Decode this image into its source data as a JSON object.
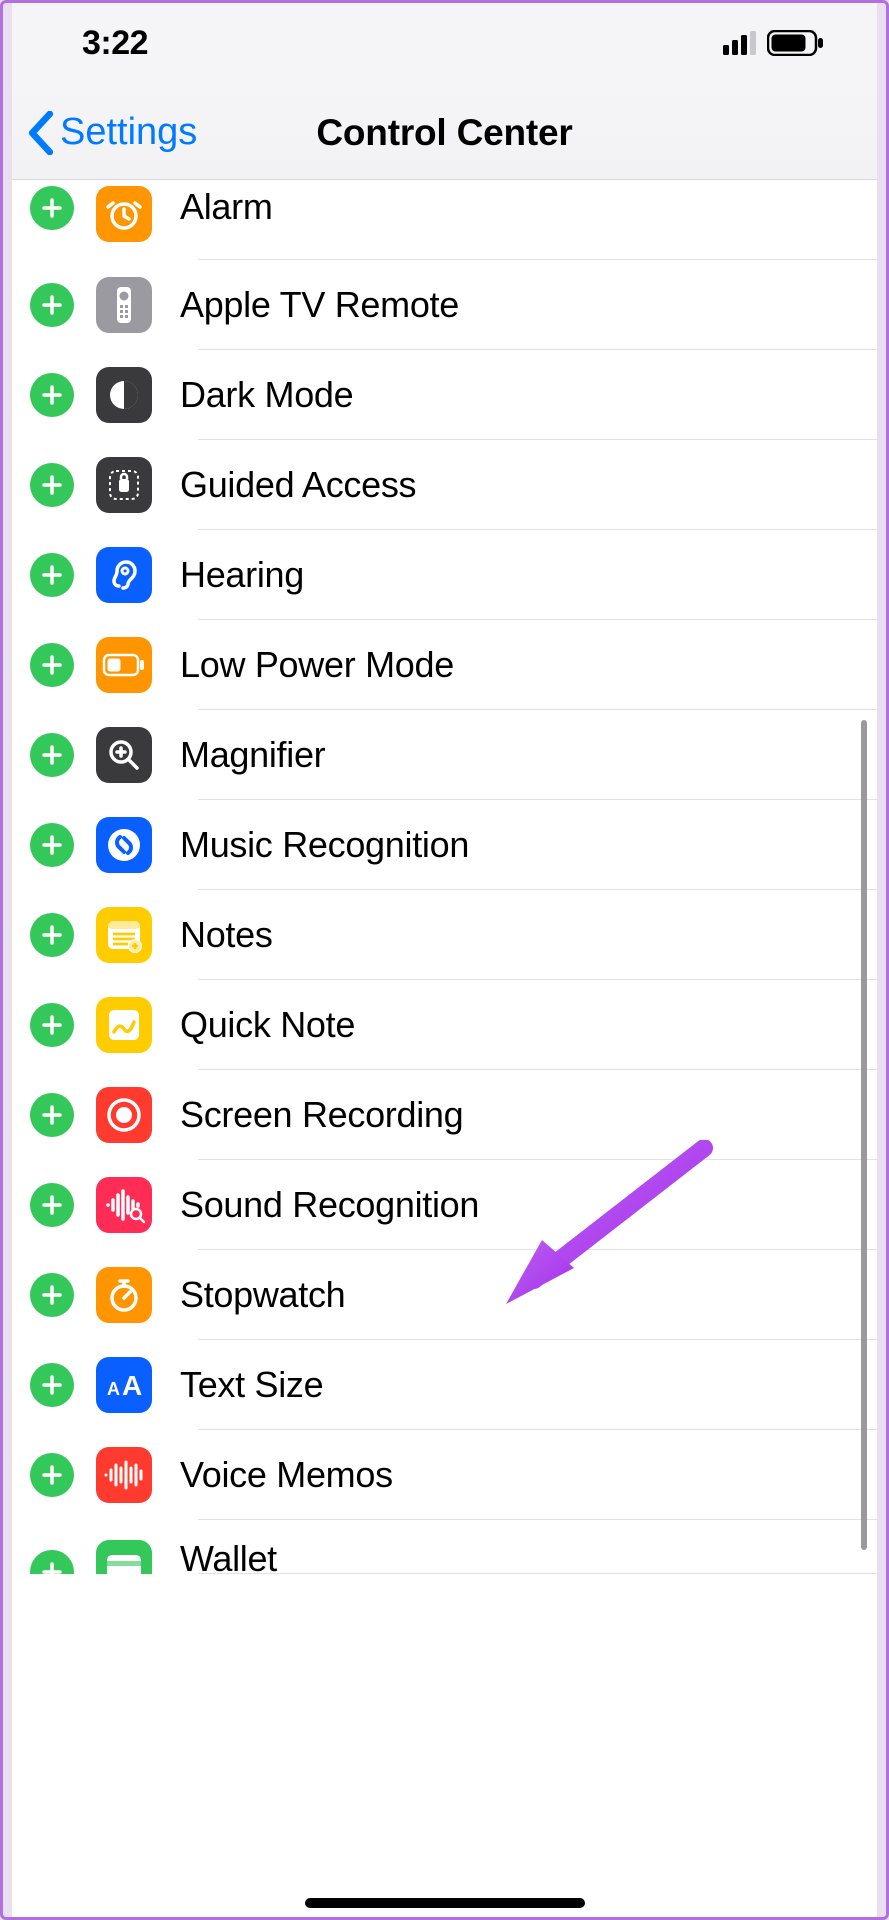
{
  "status": {
    "time": "3:22"
  },
  "nav": {
    "back_label": "Settings",
    "title": "Control Center"
  },
  "controls": [
    {
      "id": "alarm",
      "label": "Alarm",
      "icon_bg": "#ff9500",
      "icon": "alarm"
    },
    {
      "id": "apple-tv-remote",
      "label": "Apple TV Remote",
      "icon_bg": "#9a9aa0",
      "icon": "remote"
    },
    {
      "id": "dark-mode",
      "label": "Dark Mode",
      "icon_bg": "#3a3a3c",
      "icon": "darkmode"
    },
    {
      "id": "guided-access",
      "label": "Guided Access",
      "icon_bg": "#3a3a3c",
      "icon": "guided"
    },
    {
      "id": "hearing",
      "label": "Hearing",
      "icon_bg": "#0a60ff",
      "icon": "ear"
    },
    {
      "id": "low-power-mode",
      "label": "Low Power Mode",
      "icon_bg": "#ff9500",
      "icon": "battery"
    },
    {
      "id": "magnifier",
      "label": "Magnifier",
      "icon_bg": "#3a3a3c",
      "icon": "magnifier"
    },
    {
      "id": "music-recognition",
      "label": "Music Recognition",
      "icon_bg": "#0a60ff",
      "icon": "shazam"
    },
    {
      "id": "notes",
      "label": "Notes",
      "icon_bg": "#ffcc00",
      "icon": "notes"
    },
    {
      "id": "quick-note",
      "label": "Quick Note",
      "icon_bg": "#ffcc00",
      "icon": "quicknote"
    },
    {
      "id": "screen-recording",
      "label": "Screen Recording",
      "icon_bg": "#ff3b30",
      "icon": "record"
    },
    {
      "id": "sound-recognition",
      "label": "Sound Recognition",
      "icon_bg": "#ff2d55",
      "icon": "soundwave"
    },
    {
      "id": "stopwatch",
      "label": "Stopwatch",
      "icon_bg": "#ff9500",
      "icon": "stopwatch"
    },
    {
      "id": "text-size",
      "label": "Text Size",
      "icon_bg": "#0a60ff",
      "icon": "textsize"
    },
    {
      "id": "voice-memos",
      "label": "Voice Memos",
      "icon_bg": "#ff3b30",
      "icon": "voicememo"
    },
    {
      "id": "wallet",
      "label": "Wallet",
      "icon_bg": "#34c759",
      "icon": "wallet"
    }
  ],
  "annotation": {
    "points_to": "screen-recording",
    "color": "#b03cf0"
  }
}
